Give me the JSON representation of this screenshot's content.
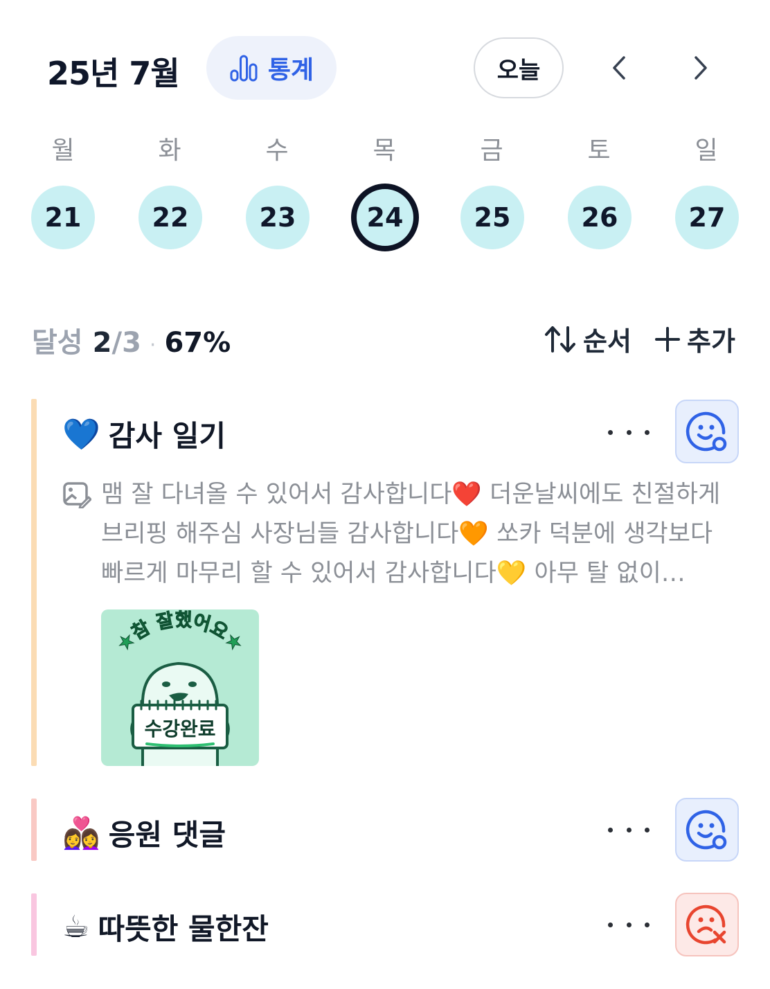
{
  "header": {
    "month_title": "25년 7월",
    "stats_label": "통계",
    "today_label": "오늘"
  },
  "week": {
    "weekdays": [
      "월",
      "화",
      "수",
      "목",
      "금",
      "토",
      "일"
    ],
    "days": [
      "21",
      "22",
      "23",
      "24",
      "25",
      "26",
      "27"
    ],
    "selected_day": "24"
  },
  "summary": {
    "label": "달성",
    "done": "2",
    "total": "/3",
    "separator": "·",
    "percent": "67%"
  },
  "actions": {
    "sort_label": "순서",
    "add_label": "추가"
  },
  "habits": [
    {
      "emoji": "💙",
      "title": "감사 일기",
      "bar_color": "#fbdcb4",
      "mood": "done",
      "note": "맴 잘 다녀올 수 있어서 감사합니다❤️ 더운날씨에도 친절하게 브리핑 해주심 사장님들 감사합니다🧡 쏘카 덕분에 생각보다 빠르게 마무리 할 수 있어서 감사합니다💛 아무 탈 없이 무사히 다녀와서 감사합니다",
      "sticker": {
        "arc_text": "★참 잘했어요★",
        "sign_text": "수강완료"
      }
    },
    {
      "emoji": "👩‍❤️‍👩",
      "title": "응원 댓글",
      "bar_color": "#f9c9c4",
      "mood": "done"
    },
    {
      "emoji": "☕",
      "title": "따뜻한 물한잔",
      "bar_color": "#f9c6e0",
      "mood": "failed"
    }
  ],
  "colors": {
    "accent_blue": "#2f62e6",
    "day_fill": "#c9f0f3",
    "mood_ok": "#2f62e6",
    "mood_bad": "#e8452f"
  }
}
